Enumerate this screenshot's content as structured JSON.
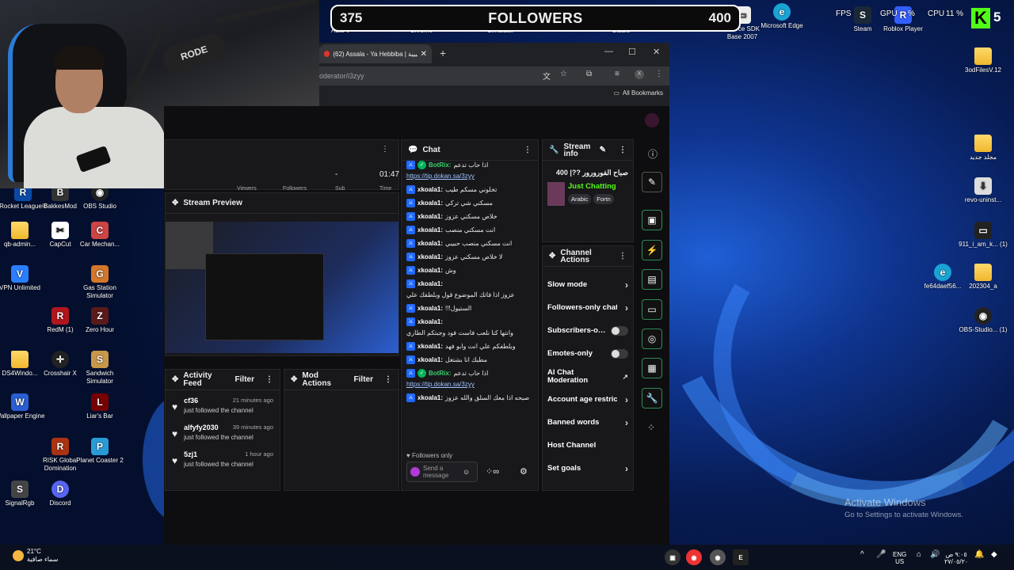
{
  "overlay": {
    "goal_current": "375",
    "goal_label": "FOLLOWERS",
    "goal_target": "400",
    "fps_label": "FPS",
    "gpu_label": "GPU",
    "gpu_value": "%",
    "cpu_label": "CPU",
    "cpu_value": "11 %",
    "kick_letter": "K",
    "kick_count": "5"
  },
  "desktop": {
    "top_icons": [
      "Steam",
      "Roblox Player",
      "Source SDK Base 2007",
      "Microsoft Edge"
    ],
    "top_partial": [
      "Auto V",
      "Chrome",
      "Simulator",
      "Studio"
    ],
    "left_icons": [
      "Rocket League®",
      "BakkesMod",
      "OBS Studio",
      "qb-admin...",
      "CapCut",
      "Car Mechan...",
      "VPN Unlimited",
      "Gas Station Simulator",
      "RedM (1)",
      "Zero Hour",
      "DS4Windo...",
      "Crosshair X",
      "Sandwich Simulator",
      "Wallpaper Engine",
      "Liar's Bar",
      "RISK Global Domination",
      "Planet Coaster 2",
      "SignalRgb",
      "Discord"
    ],
    "right_icons": [
      "3odFilesV.12",
      "مجلد جديد",
      "revo-uninst...",
      "911_i_am_k... (1)",
      "fe64daef56...",
      "202304_a",
      "OBS-Studio... (1)"
    ],
    "activate_title": "Activate Windows",
    "activate_sub": "Go to Settings to activate Windows."
  },
  "webcam": {
    "mic_brand": "RODE"
  },
  "browser": {
    "tab_title": "(62) Assala - Ya Hebbiba | حبيبة",
    "url": "oderator/i3zyy",
    "bookmarks_label": "All Bookmarks",
    "profile_initial": "X"
  },
  "dashboard": {
    "stats": {
      "dash": "-",
      "time": "01:47",
      "labels": [
        "Viewers",
        "Followers",
        "Sub",
        "Time"
      ]
    },
    "preview_title": "Stream Preview",
    "chat_title": "Chat",
    "chat_messages": [
      {
        "user": "BotRix:",
        "bot": true,
        "text": "اذا حاب تدعم",
        "link": "https://tip.dokan.sa/3zyy"
      },
      {
        "user": "xkoala1:",
        "bot": false,
        "text": "تخلوني مسكم طيب"
      },
      {
        "user": "xkoala1:",
        "bot": false,
        "text": "مسكني شي تركي"
      },
      {
        "user": "xkoala1:",
        "bot": false,
        "text": "خلاص مسكني عزوز"
      },
      {
        "user": "xkoala1:",
        "bot": false,
        "text": "انت مسكني منصب"
      },
      {
        "user": "xkoala1:",
        "bot": false,
        "text": "انت مسكني منصب حبيبي"
      },
      {
        "user": "xkoala1:",
        "bot": false,
        "text": "لا خلاص مسكني عزوز"
      },
      {
        "user": "xkoala1:",
        "bot": false,
        "text": "وش"
      },
      {
        "user": "xkoala1:",
        "bot": false,
        "text": "عزوز اذا فاتك الموضوع قول وبلطفك علي"
      },
      {
        "user": "xkoala1:",
        "bot": false,
        "text": "الستيول!!!"
      },
      {
        "user": "xkoala1:",
        "bot": false,
        "text": "وانتها كنا نلعب فاست فود وجبتكم الطاري"
      },
      {
        "user": "xkoala1:",
        "bot": false,
        "text": "وبلطفكم علي انت وابو فهد"
      },
      {
        "user": "xkoala1:",
        "bot": false,
        "text": "مطبك انا بشتغل"
      },
      {
        "user": "BotRix:",
        "bot": true,
        "text": "اذا حاب تدعم",
        "link": "https://tip.dokan.sa/3zyy"
      },
      {
        "user": "xkoala1:",
        "bot": false,
        "text": "صبحه اذا معك السلق والله عزوز"
      }
    ],
    "followers_only": "Followers only",
    "send_placeholder": "Send a message",
    "stream_info_title": "Stream info",
    "stream_title": "صباح الفورورور ??| 400",
    "category": "Just Chatting",
    "tags": [
      "Arabic",
      "Fortn"
    ],
    "channel_actions_title": "Channel Actions",
    "channel_actions": [
      {
        "label": "Slow mode",
        "kind": "chevron"
      },
      {
        "label": "Followers-only chat",
        "kind": "chevron"
      },
      {
        "label": "Subscribers-only",
        "kind": "toggle"
      },
      {
        "label": "Emotes-only",
        "kind": "toggle"
      },
      {
        "label": "AI Chat Moderation",
        "kind": "external"
      },
      {
        "label": "Account age restriction",
        "kind": "chevron"
      },
      {
        "label": "Banned words",
        "kind": "chevron"
      },
      {
        "label": "Host Channel",
        "kind": "none"
      },
      {
        "label": "Set goals",
        "kind": "chevron"
      }
    ],
    "activity_title": "Activity Feed",
    "filter_label": "Filter",
    "mod_actions_title": "Mod Actions",
    "activity": [
      {
        "user": "cf36",
        "time": "21 minutes ago",
        "desc": "just followed the channel"
      },
      {
        "user": "alfyfy2030",
        "time": "39 minutes ago",
        "desc": "just followed the channel"
      },
      {
        "user": "5zj1",
        "time": "1 hour ago",
        "desc": "just followed the channel"
      }
    ]
  },
  "taskbar": {
    "temp": "21°C",
    "weather": "سماء صافية",
    "lang": "ENG",
    "region": "US",
    "time": "٩:٠٥ ص",
    "date": "٢٧/٠٥/٢٠"
  },
  "colors": {
    "accent_green": "#53fc18",
    "panel_bg": "#18181b",
    "mod_blue": "#1f69ff"
  }
}
